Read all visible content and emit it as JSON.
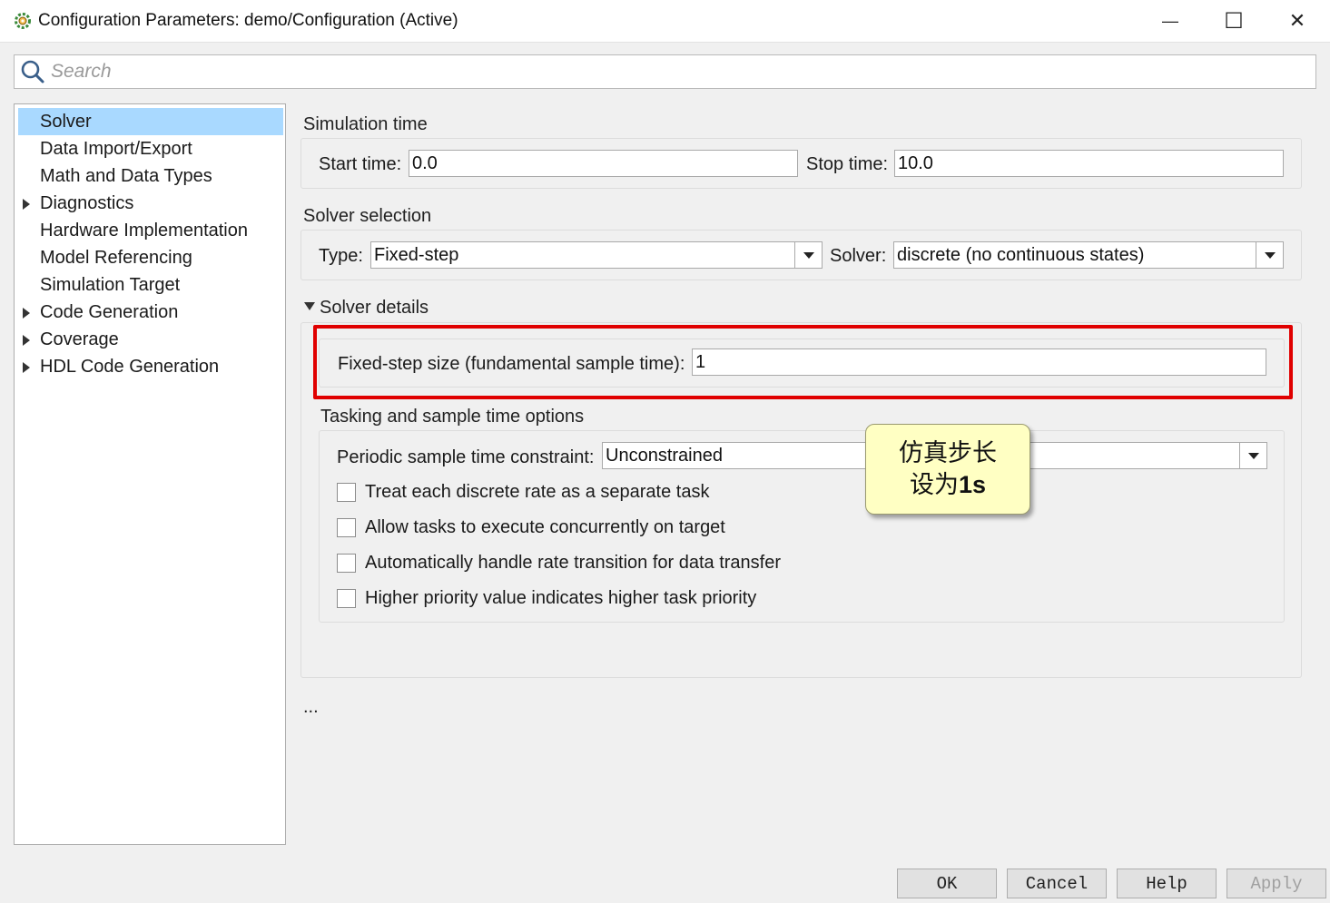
{
  "window": {
    "title": "Configuration Parameters: demo/Configuration (Active)",
    "icon": "gear-cog-icon",
    "minimize_glyph": "—",
    "maximize_glyph": "☐",
    "close_glyph": "✕"
  },
  "search": {
    "placeholder": "Search",
    "value": ""
  },
  "nav": {
    "items": [
      {
        "label": "Solver",
        "selected": true,
        "expandable": false
      },
      {
        "label": "Data Import/Export",
        "selected": false,
        "expandable": false
      },
      {
        "label": "Math and Data Types",
        "selected": false,
        "expandable": false
      },
      {
        "label": "Diagnostics",
        "selected": false,
        "expandable": true
      },
      {
        "label": "Hardware Implementation",
        "selected": false,
        "expandable": false
      },
      {
        "label": "Model Referencing",
        "selected": false,
        "expandable": false
      },
      {
        "label": "Simulation Target",
        "selected": false,
        "expandable": false
      },
      {
        "label": "Code Generation",
        "selected": false,
        "expandable": true
      },
      {
        "label": "Coverage",
        "selected": false,
        "expandable": true
      },
      {
        "label": "HDL Code Generation",
        "selected": false,
        "expandable": true
      }
    ]
  },
  "simulation_time": {
    "heading": "Simulation time",
    "start_label": "Start time:",
    "start_value": "0.0",
    "stop_label": "Stop time:",
    "stop_value": "10.0"
  },
  "solver_selection": {
    "heading": "Solver selection",
    "type_label": "Type:",
    "type_value": "Fixed-step",
    "solver_label": "Solver:",
    "solver_value": "discrete (no continuous states)"
  },
  "solver_details": {
    "heading": "Solver details",
    "step_label": "Fixed-step size (fundamental sample time):",
    "step_value": "1"
  },
  "tasking": {
    "heading": "Tasking and sample time options",
    "constraint_label": "Periodic sample time constraint:",
    "constraint_value": "Unconstrained",
    "checkboxes": [
      {
        "label": "Treat each discrete rate as a separate task",
        "checked": false
      },
      {
        "label": "Allow tasks to execute concurrently on target",
        "checked": false
      },
      {
        "label": "Automatically handle rate transition for data transfer",
        "checked": false
      },
      {
        "label": "Higher priority value indicates higher task priority",
        "checked": false
      }
    ]
  },
  "more_indicator": "...",
  "annotation": {
    "line1": "仿真步长",
    "line2_prefix": "设为",
    "line2_bold": "1s",
    "highlight_color": "#e00000",
    "note_bg": "#ffffc3"
  },
  "footer": {
    "ok": "OK",
    "cancel": "Cancel",
    "help": "Help",
    "apply": "Apply"
  },
  "colors": {
    "selection": "#a9d9ff",
    "window_bg": "#f0f0f0"
  }
}
